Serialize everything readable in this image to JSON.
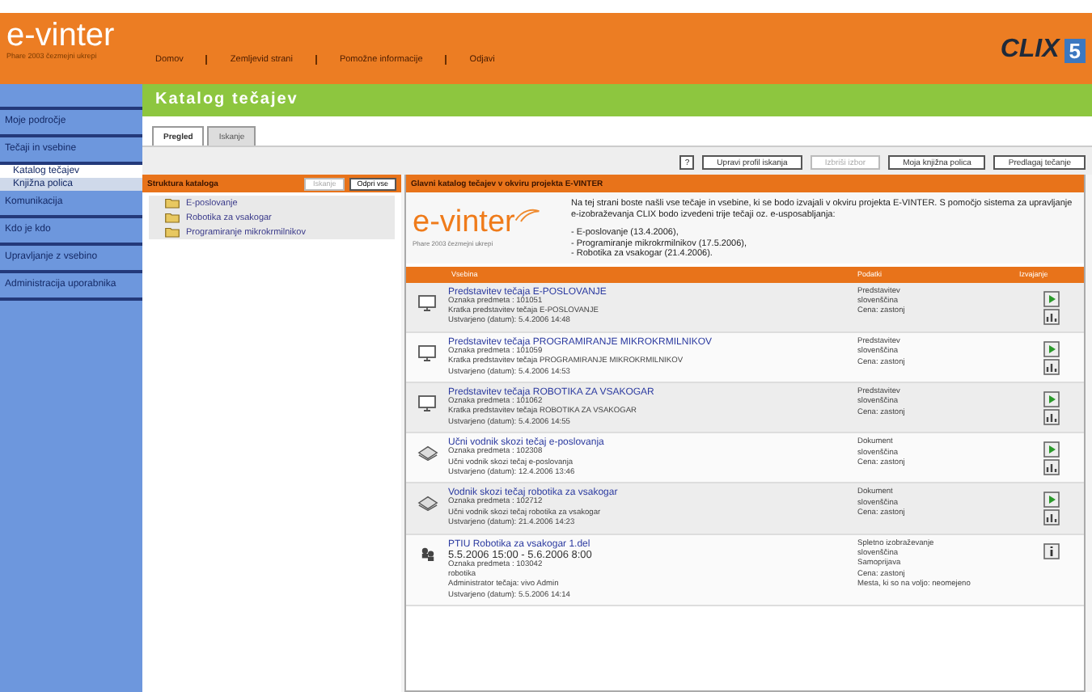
{
  "header": {
    "logo": "e-vinter",
    "logo_subtitle": "Phare 2003 čezmejni ukrepi",
    "nav": [
      "Domov",
      "Zemljevid strani",
      "Pomožne informacije",
      "Odjavi"
    ],
    "brand": "CLIX",
    "brand_version": "5"
  },
  "sidebar": {
    "items": [
      {
        "label": "Moje področje",
        "selected": false
      },
      {
        "label": "Tečaji in vsebine",
        "selected": false,
        "children": [
          {
            "label": "Katalog tečajev",
            "selected": true
          },
          {
            "label": "Knjižna polica",
            "selected": false
          }
        ]
      },
      {
        "label": "Komunikacija",
        "selected": false
      },
      {
        "label": "Kdo je kdo",
        "selected": false
      },
      {
        "label": "Upravljanje z vsebino",
        "selected": false
      },
      {
        "label": "Administracija uporabnika",
        "selected": false
      }
    ]
  },
  "page_title": "Katalog tečajev",
  "tabs": [
    {
      "label": "Pregled",
      "selected": true
    },
    {
      "label": "Iskanje",
      "selected": false
    }
  ],
  "toolbar": {
    "help": "?",
    "buttons": [
      {
        "label": "Upravi profil iskanja",
        "disabled": false
      },
      {
        "label": "Izbriši izbor",
        "disabled": true
      },
      {
        "label": "Moja knjižna polica",
        "disabled": false
      },
      {
        "label": "Predlagaj tečanje",
        "disabled": false
      }
    ]
  },
  "structure_panel": {
    "title": "Struktura kataloga",
    "search_button": {
      "label": "Iskanje",
      "disabled": true
    },
    "open_all_button": {
      "label": "Odpri vse",
      "disabled": false
    },
    "folders": [
      {
        "label": "E-poslovanje"
      },
      {
        "label": "Robotika za vsakogar"
      },
      {
        "label": "Programiranje mikrokrmilnikov"
      }
    ]
  },
  "main_panel": {
    "title": "Glavni katalog tečajev v okviru projekta E-VINTER",
    "logo": "e-vinter",
    "logo_subtitle": "Phare 2003 čezmejni ukrepi",
    "intro": "Na tej strani boste našli vse tečaje in vsebine, ki se bodo izvajali v okviru projekta E-VINTER. S pomočjo sistema za upravljanje e-izobraževanja CLIX bodo izvedeni trije tečaji oz. e-usposabljanja:",
    "intro_list": [
      "- E-poslovanje (13.4.2006),",
      "- Programiranje mikrokrmilnikov (17.5.2006),",
      "- Robotika za vsakogar (21.4.2006)."
    ],
    "table": {
      "columns": [
        "Vsebina",
        "Podatki",
        "Izvajanje"
      ],
      "rows": [
        {
          "kind": "course",
          "title": "Predstavitev tečaja E-POSLOVANJE",
          "details": [
            "Oznaka predmeta : 101051",
            "Kratka predstavitev tečaja E-POSLOVANJE",
            "Ustvarjeno (datum): 5.4.2006 14:48"
          ],
          "info": [
            "Predstavitev",
            "slovenščina",
            "Cena: zastonj"
          ],
          "actions": [
            {
              "kind": "play"
            },
            {
              "kind": "stats"
            }
          ]
        },
        {
          "kind": "course",
          "title": "Predstavitev tečaja PROGRAMIRANJE MIKROKRMILNIKOV",
          "details": [
            "Oznaka predmeta : 101059",
            "Kratka predstavitev tečaja PROGRAMIRANJE MIKROKRMILNIKOV",
            "Ustvarjeno (datum): 5.4.2006 14:53"
          ],
          "info": [
            "Predstavitev",
            "slovenščina",
            "Cena: zastonj"
          ],
          "actions": [
            {
              "kind": "play"
            },
            {
              "kind": "stats"
            }
          ]
        },
        {
          "kind": "course",
          "title": "Predstavitev tečaja ROBOTIKA ZA VSAKOGAR",
          "details": [
            "Oznaka predmeta : 101062",
            "Kratka predstavitev tečaja ROBOTIKA ZA VSAKOGAR",
            "Ustvarjeno (datum): 5.4.2006 14:55"
          ],
          "info": [
            "Predstavitev",
            "slovenščina",
            "Cena: zastonj"
          ],
          "actions": [
            {
              "kind": "play"
            },
            {
              "kind": "stats"
            }
          ]
        },
        {
          "kind": "document",
          "title": "Učni vodnik skozi tečaj e-poslovanja",
          "details": [
            "Oznaka predmeta : 102308",
            "Učni vodnik skozi tečaj e-poslovanja",
            "Ustvarjeno (datum): 12.4.2006 13:46"
          ],
          "info": [
            "Dokument",
            "slovenščina",
            "Cena: zastonj"
          ],
          "actions": [
            {
              "kind": "play"
            },
            {
              "kind": "stats"
            }
          ]
        },
        {
          "kind": "document",
          "title": "Vodnik skozi tečaj robotika za vsakogar",
          "details": [
            "Oznaka predmeta : 102712",
            "Učni vodnik skozi tečaj robotika za vsakogar",
            "Ustvarjeno (datum): 21.4.2006 14:23"
          ],
          "info": [
            "Dokument",
            "slovenščina",
            "Cena: zastonj"
          ],
          "actions": [
            {
              "kind": "play"
            },
            {
              "kind": "stats"
            }
          ]
        },
        {
          "kind": "event",
          "title": "PTIU Robotika za vsakogar 1.del",
          "dates": "5.5.2006 15:00 - 5.6.2006 8:00",
          "details": [
            "Oznaka predmeta : 103042",
            "robotika",
            "Administrator tečaja: vivo Admin",
            "Ustvarjeno (datum): 5.5.2006 14:14"
          ],
          "info": [
            "Spletno izobraževanje",
            "slovenščina",
            "Samoprijava",
            "Cena: zastonj",
            "Mesta, ki so na voljo: neomejeno"
          ],
          "actions": [
            {
              "kind": "info"
            }
          ]
        }
      ]
    }
  }
}
